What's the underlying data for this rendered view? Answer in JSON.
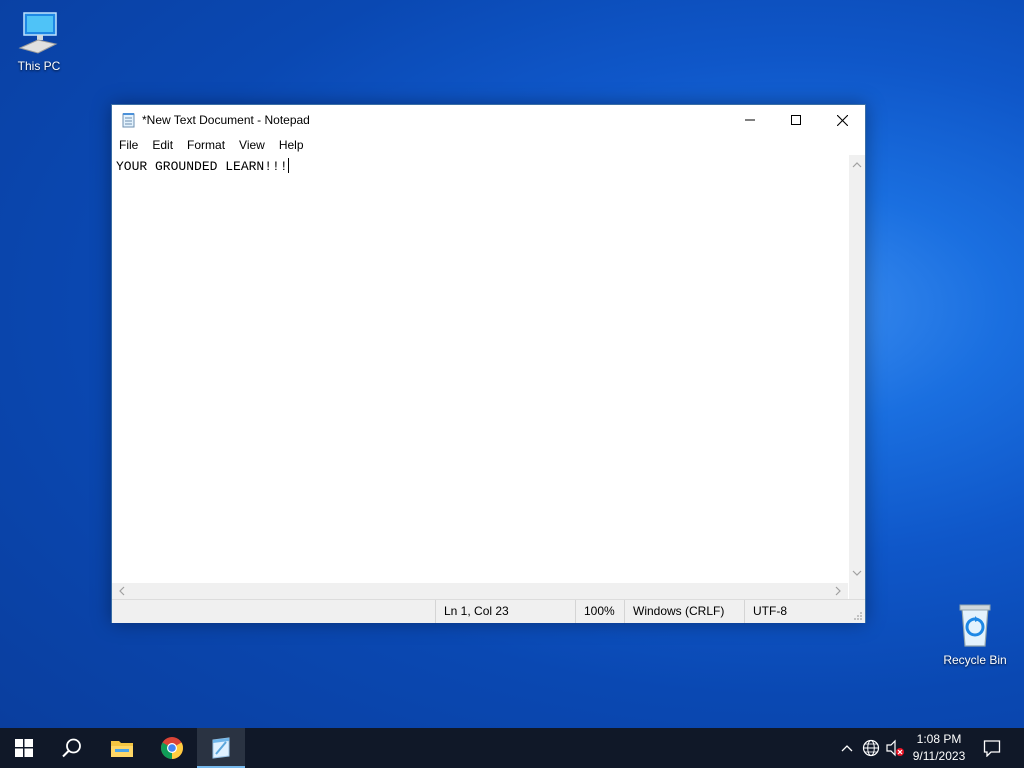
{
  "desktop": {
    "icons": [
      {
        "label": "This PC",
        "icon": "computer-icon"
      },
      {
        "label": "Recycle Bin",
        "icon": "recycle-bin-icon"
      }
    ]
  },
  "notepad": {
    "title": "*New Text Document - Notepad",
    "menu": [
      "File",
      "Edit",
      "Format",
      "View",
      "Help"
    ],
    "content": "YOUR GROUNDED LEARN!!!",
    "status": {
      "position": "Ln 1, Col 23",
      "zoom": "100%",
      "line_ending": "Windows (CRLF)",
      "encoding": "UTF-8"
    }
  },
  "taskbar": {
    "apps": [
      "start-icon",
      "search-icon",
      "file-explorer-icon",
      "chrome-icon",
      "notepad-icon"
    ],
    "clock": {
      "time": "1:08 PM",
      "date": "9/11/2023"
    }
  },
  "colors": {
    "accent": "#76b9ed",
    "taskbar_bg": "#101828",
    "desktop_bg": "#0f57c9"
  }
}
